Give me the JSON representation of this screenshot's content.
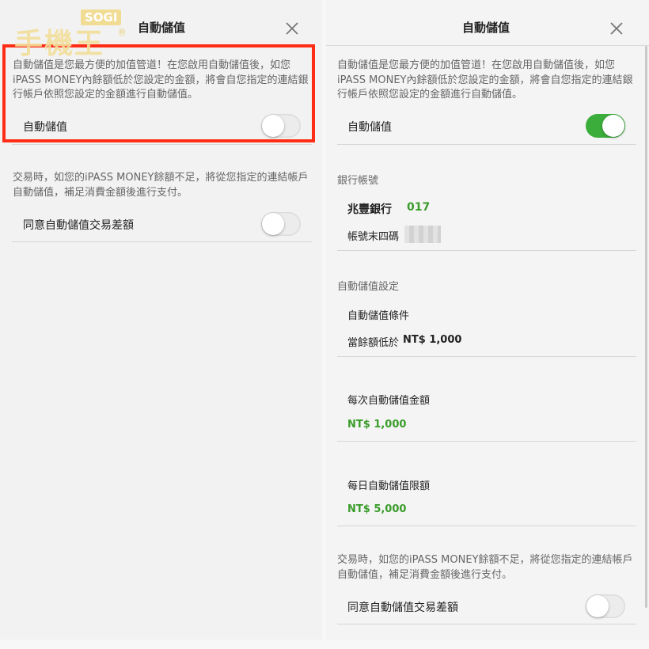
{
  "watermark": {
    "text": "手機王",
    "badge": "SOGI",
    "mark": "®"
  },
  "left": {
    "title": "自動儲值",
    "description": "自動儲值是您最方便的加值管道！在您啟用自動儲值後，如您iPASS MONEY內餘額低於您設定的金額，將會自您指定的連結銀行帳戶依照您設定的金額進行自動儲值。",
    "auto_topup_label": "自動儲值",
    "auto_topup_on": false,
    "shortfall_description": "交易時，如您的iPASS MONEY餘額不足，將從您指定的連結帳戶自動儲值，補足消費金額後進行支付。",
    "shortfall_label": "同意自動儲值交易差額",
    "shortfall_on": false
  },
  "right": {
    "title": "自動儲值",
    "description": "自動儲值是您最方便的加值管道！在您啟用自動儲值後，如您iPASS MONEY內餘額低於您設定的金額，將會自您指定的連結銀行帳戶依照您設定的金額進行自動儲值。",
    "auto_topup_label": "自動儲值",
    "auto_topup_on": true,
    "bank_section_title": "銀行帳號",
    "bank_name": "兆豐銀行",
    "bank_code": "017",
    "account_last4_label": "帳號末四碼",
    "settings_section_title": "自動儲值設定",
    "condition_label": "自動儲值條件",
    "condition_prefix": "當餘額低於",
    "condition_amount": "NT$ 1,000",
    "per_amount_label": "每次自動儲值金額",
    "per_amount_value": "NT$ 1,000",
    "daily_limit_label": "每日自動儲值限額",
    "daily_limit_value": "NT$ 5,000",
    "shortfall_description": "交易時，如您的iPASS MONEY餘額不足，將從您指定的連結帳戶自動儲值，補足消費金額後進行支付。",
    "shortfall_label": "同意自動儲值交易差額",
    "shortfall_on": false
  },
  "icons": {
    "close": "close-icon"
  },
  "colors": {
    "accent_green": "#3bad3b",
    "value_green": "#3a9c2a",
    "highlight_red": "#ff2d16"
  }
}
